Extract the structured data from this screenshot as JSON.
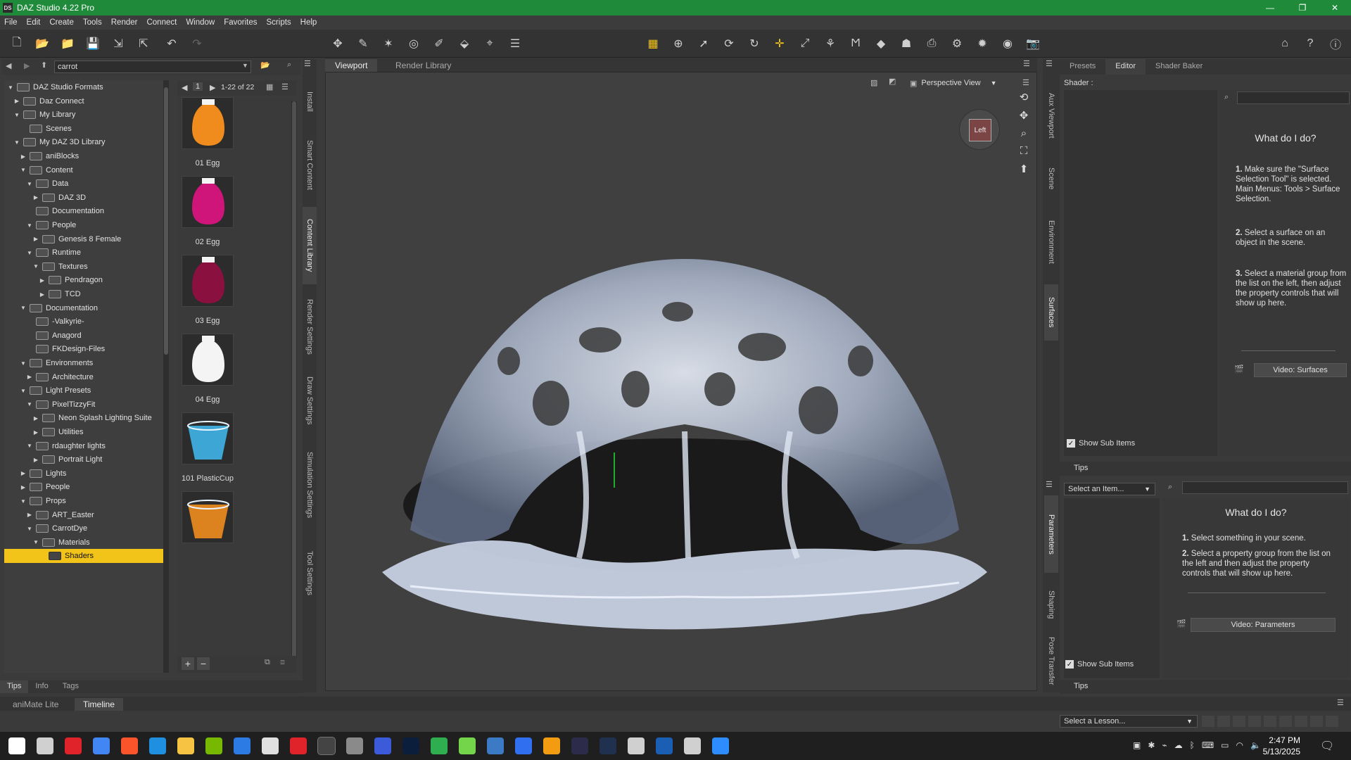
{
  "window": {
    "title": "DAZ Studio 4.22 Pro",
    "app_icon_text": "DS",
    "controls": [
      "—",
      "❐",
      "✕"
    ]
  },
  "menu": [
    "File",
    "Edit",
    "Create",
    "Tools",
    "Render",
    "Connect",
    "Window",
    "Favorites",
    "Scripts",
    "Help"
  ],
  "content_library": {
    "search_value": "carrot",
    "tree": [
      {
        "label": "DAZ Studio Formats",
        "depth": 0,
        "arrow": "▼"
      },
      {
        "label": "Daz Connect",
        "depth": 1,
        "arrow": "▶"
      },
      {
        "label": "My Library",
        "depth": 1,
        "arrow": "▼"
      },
      {
        "label": "Scenes",
        "depth": 2,
        "arrow": ""
      },
      {
        "label": "My DAZ 3D Library",
        "depth": 1,
        "arrow": "▼"
      },
      {
        "label": "aniBlocks",
        "depth": 2,
        "arrow": "▶"
      },
      {
        "label": "Content",
        "depth": 2,
        "arrow": "▼"
      },
      {
        "label": "Data",
        "depth": 3,
        "arrow": "▼"
      },
      {
        "label": "DAZ 3D",
        "depth": 4,
        "arrow": "▶"
      },
      {
        "label": "Documentation",
        "depth": 3,
        "arrow": ""
      },
      {
        "label": "People",
        "depth": 3,
        "arrow": "▼"
      },
      {
        "label": "Genesis 8 Female",
        "depth": 4,
        "arrow": "▶"
      },
      {
        "label": "Runtime",
        "depth": 3,
        "arrow": "▼"
      },
      {
        "label": "Textures",
        "depth": 4,
        "arrow": "▼"
      },
      {
        "label": "Pendragon",
        "depth": 5,
        "arrow": "▶"
      },
      {
        "label": "TCD",
        "depth": 5,
        "arrow": "▶"
      },
      {
        "label": "Documentation",
        "depth": 2,
        "arrow": "▼"
      },
      {
        "label": "-Valkyrie-",
        "depth": 3,
        "arrow": ""
      },
      {
        "label": "Anagord",
        "depth": 3,
        "arrow": ""
      },
      {
        "label": "FKDesign-Files",
        "depth": 3,
        "arrow": ""
      },
      {
        "label": "Environments",
        "depth": 2,
        "arrow": "▼"
      },
      {
        "label": "Architecture",
        "depth": 3,
        "arrow": "▶"
      },
      {
        "label": "Light Presets",
        "depth": 2,
        "arrow": "▼"
      },
      {
        "label": "PixelTizzyFit",
        "depth": 3,
        "arrow": "▼"
      },
      {
        "label": "Neon Splash Lighting Suite",
        "depth": 4,
        "arrow": "▶"
      },
      {
        "label": "Utilities",
        "depth": 4,
        "arrow": "▶"
      },
      {
        "label": "rdaughter lights",
        "depth": 3,
        "arrow": "▼"
      },
      {
        "label": "Portrait Light",
        "depth": 4,
        "arrow": "▶"
      },
      {
        "label": "Lights",
        "depth": 2,
        "arrow": "▶"
      },
      {
        "label": "People",
        "depth": 2,
        "arrow": "▶"
      },
      {
        "label": "Props",
        "depth": 2,
        "arrow": "▼"
      },
      {
        "label": "ART_Easter",
        "depth": 3,
        "arrow": "▶"
      },
      {
        "label": "CarrotDye",
        "depth": 3,
        "arrow": "▼"
      },
      {
        "label": "Materials",
        "depth": 4,
        "arrow": "▼"
      },
      {
        "label": "Shaders",
        "depth": 5,
        "arrow": "",
        "selected": true
      }
    ],
    "pager": {
      "page": "1",
      "range": "1-22 of 22"
    },
    "thumbnails": [
      {
        "label": "01 Egg",
        "color": "#f08c1e",
        "shape": "egg"
      },
      {
        "label": "02 Egg",
        "color": "#d0157a",
        "shape": "egg"
      },
      {
        "label": "03 Egg",
        "color": "#8a1040",
        "shape": "egg"
      },
      {
        "label": "04 Egg",
        "color": "#f4f4f4",
        "shape": "egg"
      },
      {
        "label": "101 PlasticCup",
        "color": "#3fb4e8",
        "shape": "cup"
      },
      {
        "label": "",
        "color": "#f08c1e",
        "shape": "cup"
      }
    ],
    "bottom_tabs": [
      "Tips",
      "Info",
      "Tags"
    ],
    "left_vtabs": [
      "Install",
      "Smart Content",
      "Content Library",
      "Render Settings",
      "Draw Settings",
      "Simulation Settings",
      "Tool Settings"
    ],
    "add_label": "+",
    "remove_label": "−"
  },
  "viewport": {
    "tabs": [
      "Viewport",
      "Render Library"
    ],
    "camera": "Perspective View",
    "cube_label": "Left"
  },
  "right_vtabs": [
    "Aux Viewport",
    "Scene",
    "Environment",
    "Surfaces",
    "Parameters",
    "Shaping",
    "Pose Transfer"
  ],
  "surfaces": {
    "tabs": [
      "Presets",
      "Editor",
      "Shader Baker"
    ],
    "shader_label": "Shader :",
    "help_title": "What do I do?",
    "steps": [
      {
        "num": "1.",
        "text": "Make sure the \"Surface Selection Tool\" is selected. Main Menus: Tools > Surface Selection."
      },
      {
        "num": "2.",
        "text": "Select a surface on an object in the scene."
      },
      {
        "num": "3.",
        "text": "Select a material group from the list on the left, then adjust the property controls that will show up here."
      }
    ],
    "video_label": "Video: Surfaces",
    "show_sub_items": "Show Sub Items",
    "tips": "Tips"
  },
  "parameters": {
    "select_placeholder": "Select an Item...",
    "help_title": "What do I do?",
    "steps": [
      {
        "num": "1.",
        "text": "Select something in your scene."
      },
      {
        "num": "2.",
        "text": "Select a property group from the list on the left and then adjust the property controls that will show up here."
      }
    ],
    "video_label": "Video: Parameters",
    "show_sub_items": "Show Sub Items",
    "tips": "Tips"
  },
  "bottom": {
    "tabs": [
      "aniMate Lite",
      "Timeline"
    ],
    "lesson_placeholder": "Select a Lesson..."
  },
  "taskbar": {
    "time": "2:47 PM",
    "date": "5/13/2025",
    "icons": [
      "windows-start",
      "task-view",
      "opera",
      "chrome",
      "brave",
      "firefox",
      "file-explorer",
      "nvidia",
      "app-bolt",
      "store",
      "app-red",
      "daz-studio",
      "app-gray",
      "app-blue",
      "photoshop",
      "app-green",
      "cloud",
      "qbittorrent",
      "app-arc",
      "vlc",
      "app-dark",
      "davinci",
      "app-tools",
      "app-ab",
      "obs",
      "zoom"
    ]
  }
}
